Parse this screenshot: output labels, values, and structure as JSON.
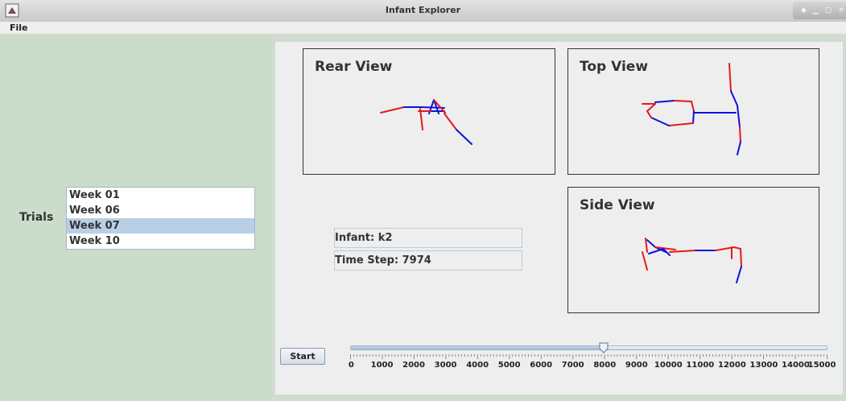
{
  "window": {
    "title": "Infant Explorer",
    "app_icon": "java-app-icon"
  },
  "menu": {
    "file_label": "File"
  },
  "trials": {
    "label": "Trials",
    "items": [
      "Week 01",
      "Week 06",
      "Week 07",
      "Week 10"
    ],
    "selected": "Week 07"
  },
  "views": {
    "rear": {
      "title": "Rear View"
    },
    "top": {
      "title": "Top View"
    },
    "side": {
      "title": "Side View"
    }
  },
  "info": {
    "infant": "Infant: k2",
    "time_step": "Time Step: 7974"
  },
  "controls": {
    "start_label": "Start"
  },
  "slider": {
    "min": 0,
    "max": 15000,
    "value": 7974,
    "labels": [
      "0",
      "1000",
      "2000",
      "3000",
      "4000",
      "5000",
      "6000",
      "7000",
      "8000",
      "9000",
      "10000",
      "11000",
      "12000",
      "13000",
      "14000",
      "15000"
    ]
  },
  "colors": {
    "limb_red": "#e41a1a",
    "limb_blue": "#1010e0",
    "panel_green": "#cbdccb",
    "selection": "#b8cfe5"
  }
}
